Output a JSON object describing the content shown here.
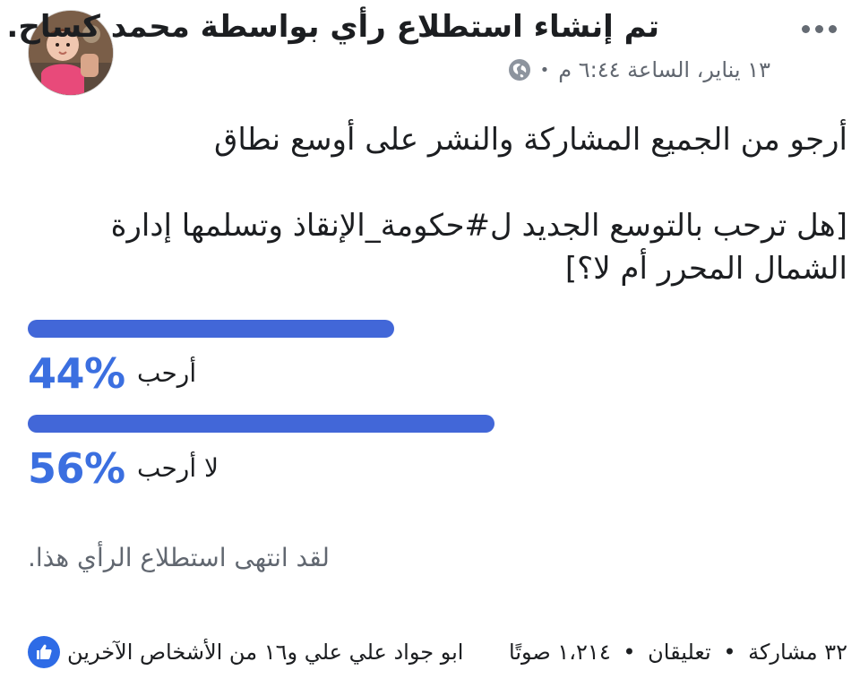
{
  "header": {
    "author_name": "محمد كساح",
    "title_prefix": "تم إنشاء استطلاع رأي بواسطة",
    "title_suffix": ".",
    "timestamp": "١٣ يناير، الساعة ٦:٤٤ م",
    "meta_separator": "•",
    "privacy_icon": "globe-icon",
    "more_icon": "more-horizontal-icon",
    "avatar_icon": "avatar-photo"
  },
  "post": {
    "line1": "أرجو من الجميع المشاركة والنشر على أوسع نطاق",
    "line2": "[هل ترحب بالتوسع الجديد ل#حكومة_الإنقاذ وتسلمها إدارة الشمال المحرر أم لا؟]"
  },
  "poll": {
    "options": [
      {
        "label": "أرحب",
        "percent": 44,
        "percent_text": "44%"
      },
      {
        "label": "لا أرحب",
        "percent": 56,
        "percent_text": "56%"
      }
    ],
    "ended_text": "لقد انتهى استطلاع الرأي هذا.",
    "bar_color": "#4267d8",
    "percent_color": "#3b6fe0"
  },
  "footer": {
    "reactors_text": "ابو جواد علي علي و١٦ من الأشخاص الآخرين",
    "votes_text": "١،٢١٤ صوتًا",
    "comments_text": "تعليقان",
    "shares_text": "٣٢ مشاركة",
    "separator": "•",
    "reaction_icon": "like-icon",
    "reaction_color": "#2e6be6"
  }
}
